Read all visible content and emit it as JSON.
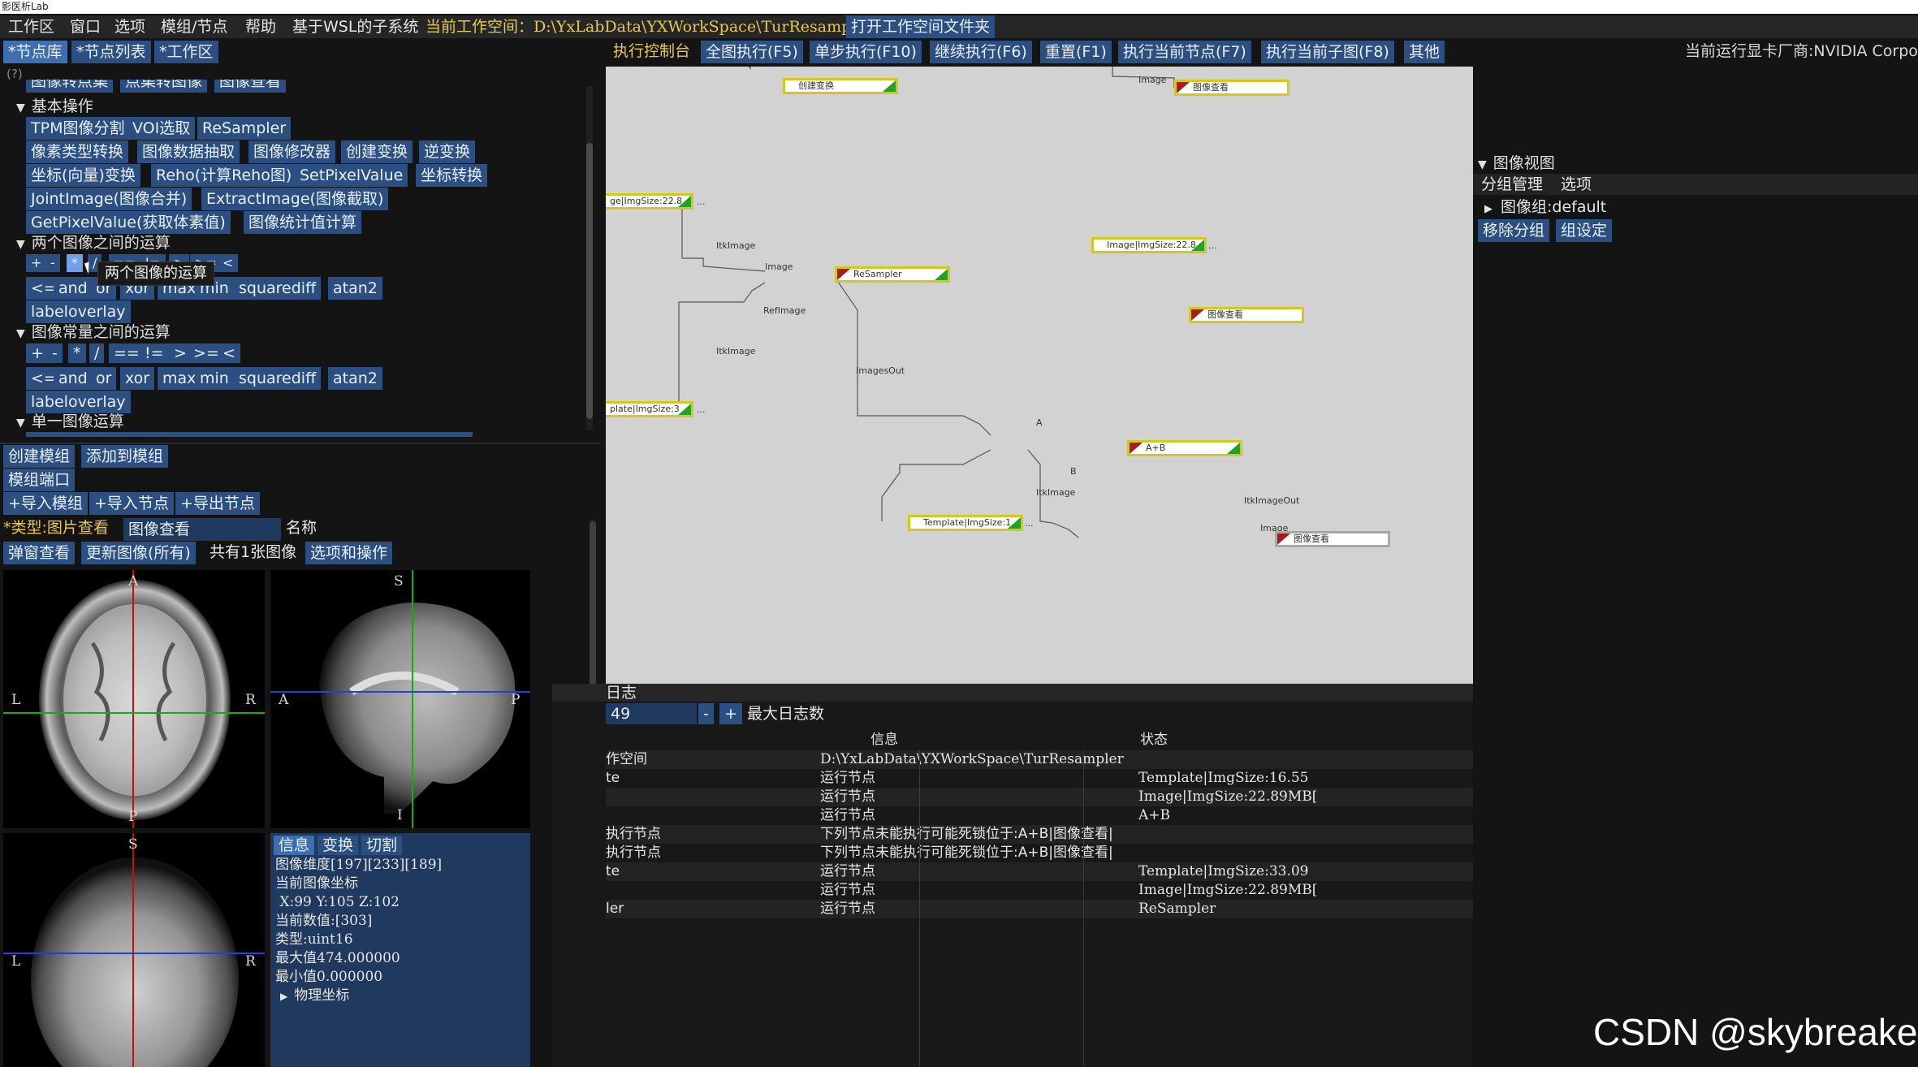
{
  "app": {
    "title": "影医析Lab"
  },
  "menubar": {
    "items": [
      "工作区",
      "窗口",
      "选项",
      "模组/节点",
      "帮助",
      "基于WSL的子系统"
    ],
    "workspace_label": "当前工作空间：D:\\YxLabData\\YXWorkSpace\\TurResampler",
    "open_folder": "打开工作空间文件夹"
  },
  "left_tabs": [
    "*节点库",
    "*节点列表",
    "*工作区"
  ],
  "left_help": "(?)",
  "node_lib": {
    "partial_row": [
      "图像转点集",
      "点集转图像",
      "图像查看"
    ],
    "basic_ops": {
      "title": "基本操作",
      "rows": [
        [
          "TPM图像分割",
          "VOI选取",
          "ReSampler"
        ],
        [
          "像素类型转换",
          "图像数据抽取",
          "图像修改器",
          "创建变换",
          "逆变换"
        ],
        [
          "坐标(向量)变换",
          "Reho(计算Reho图)",
          "SetPixelValue",
          "坐标转换"
        ],
        [
          "JointImage(图像合并)",
          "ExtractImage(图像截取)"
        ],
        [
          "GetPixelValue(获取体素值)",
          "图像统计值计算"
        ]
      ]
    },
    "two_image_ops": {
      "title": "两个图像之间的运算",
      "row1": [
        "+",
        "-",
        "*",
        "/",
        "==",
        "!=",
        ">",
        ">=",
        "<"
      ],
      "row2": [
        "<=",
        "and",
        "or",
        "xor",
        "max",
        "min",
        "squarediff",
        "atan2"
      ],
      "row3": [
        "labeloverlay"
      ],
      "tooltip": "两个图像的运算"
    },
    "image_const_ops": {
      "title": "图像常量之间的运算",
      "row1": [
        "+",
        "-",
        "*",
        "/",
        "==",
        "!=",
        ">",
        ">=",
        "<"
      ],
      "row2": [
        "<=",
        "and",
        "or",
        "xor",
        "max",
        "min",
        "squarediff",
        "atan2"
      ],
      "row3": [
        "labeloverlay"
      ]
    },
    "single_image_ops": {
      "title": "单一图像运算"
    }
  },
  "module_buttons": {
    "create_module": "创建模组",
    "add_to_module": "添加到模组",
    "module_port": "模组端口",
    "import_module": "+导入模组",
    "import_node": "+导入节点",
    "export_node": "+导出节点"
  },
  "node_props": {
    "type_label": "*类型:图片查看",
    "name_value": "图像查看",
    "name_label": "名称",
    "popup_view": "弹窗查看",
    "refresh_all": "更新图像(所有)",
    "image_count": "共有1张图像",
    "options_ops": "选项和操作"
  },
  "viewers": {
    "axial": {
      "top": "A",
      "bottom": "P",
      "left": "L",
      "right": "R"
    },
    "sagittal": {
      "top": "S",
      "bottom": "I",
      "left": "A",
      "right": "P"
    },
    "coronal": {
      "top": "S",
      "left": "L",
      "right": "R"
    }
  },
  "info_panel": {
    "tabs": [
      "信息",
      "变换",
      "切割"
    ],
    "lines": [
      "图像维度[197][233][189]",
      "当前图像坐标",
      " X:99 Y:105 Z:102",
      "当前数值:[303]",
      "类型:uint16",
      "最大值474.000000",
      "最小值0.000000"
    ],
    "phys": "物理坐标"
  },
  "exec_toolbar": {
    "title": "执行控制台",
    "buttons": [
      "全图执行(F5)",
      "单步执行(F10)",
      "继续执行(F6)",
      "重置(F1)",
      "执行当前节点(F7)",
      "执行当前子图(F8)",
      "其他"
    ],
    "gpu": "当前运行显卡厂商:NVIDIA Corpo"
  },
  "graph": {
    "nodes": {
      "create_transform": "创建变换",
      "viewer_top": "图像查看",
      "image_left": "ge|ImgSize:22.8",
      "resampler": "ReSampler",
      "image_mid": "Image|ImgSize:22.8",
      "viewer_mid": "图像查看",
      "template_left": "plate|ImgSize:3",
      "aplusb": "A+B",
      "template_bottom": "Template|ImgSize:1",
      "viewer_bottom": "图像查看"
    },
    "ports": {
      "image_top": "Image",
      "itkimage1": "ItkImage",
      "image_in": "Image",
      "refimage": "RefImage",
      "itkimage2": "ItkImage",
      "imagesout": "ImagesOut",
      "a": "A",
      "b": "B",
      "itkimage3": "ItkImage",
      "itkimageout": "ItkImageOut",
      "image_bottom": "Image"
    },
    "ellipsis": "..."
  },
  "image_view_panel": {
    "title": "图像视图",
    "menu": [
      "分组管理",
      "选项"
    ],
    "group": "图像组:default",
    "buttons": [
      "移除分组",
      "组设定"
    ]
  },
  "log": {
    "title": "日志",
    "count": "49",
    "minus": "-",
    "plus": "+",
    "max_label": "最大日志数",
    "columns": [
      "信息",
      "状态"
    ],
    "rows": [
      {
        "c0": "作空间",
        "c1": "D:\\YxLabData\\YXWorkSpace\\TurResampler",
        "c2": ""
      },
      {
        "c0": "te",
        "c1": "运行节点",
        "c2": "Template|ImgSize:16.55"
      },
      {
        "c0": "",
        "c1": "运行节点",
        "c2": "Image|ImgSize:22.89MB["
      },
      {
        "c0": "",
        "c1": "运行节点",
        "c2": "A+B"
      },
      {
        "c0": "执行节点",
        "c1": "下列节点未能执行可能死锁位于:A+B|图像查看|",
        "c2": ""
      },
      {
        "c0": "执行节点",
        "c1": "下列节点未能执行可能死锁位于:A+B|图像查看|",
        "c2": ""
      },
      {
        "c0": "te",
        "c1": "运行节点",
        "c2": "Template|ImgSize:33.09"
      },
      {
        "c0": "",
        "c1": "运行节点",
        "c2": "Image|ImgSize:22.89MB["
      },
      {
        "c0": "ler",
        "c1": "运行节点",
        "c2": "ReSampler"
      }
    ]
  },
  "watermark": "CSDN @skybreaker",
  "colors": {
    "accent": "#2a4f80",
    "node_border": "#d4c81c",
    "node_ok": "#27a027",
    "node_err": "#b01818",
    "canvas": "#d2d2d2",
    "panel": "#141414"
  }
}
